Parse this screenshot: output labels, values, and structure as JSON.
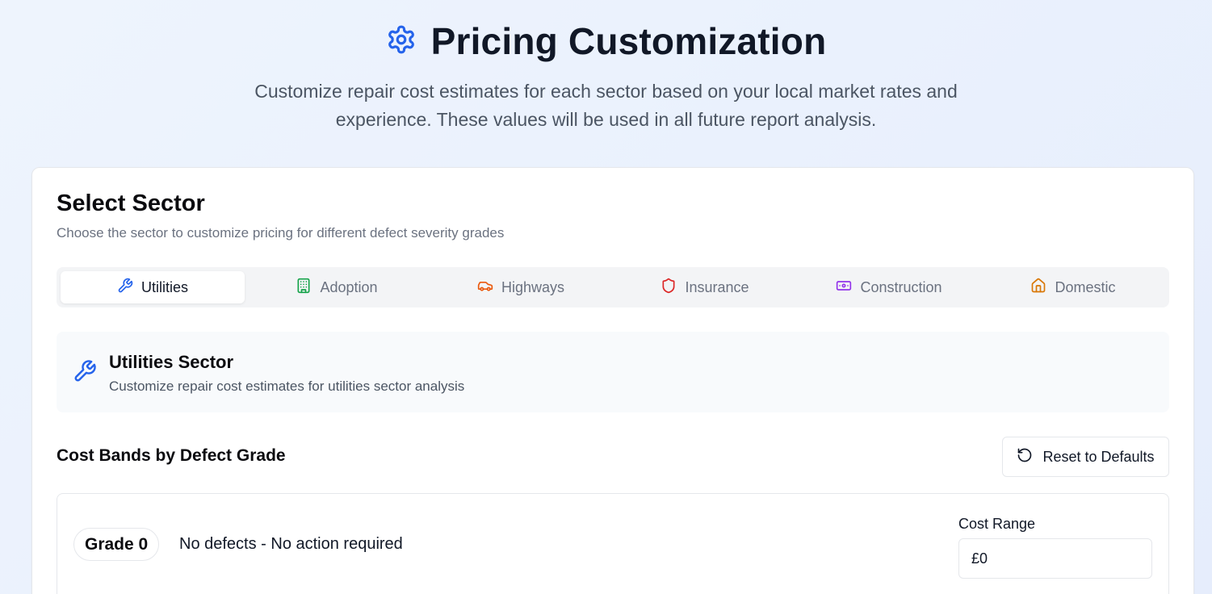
{
  "header": {
    "title": "Pricing Customization",
    "subtitle": "Customize repair cost estimates for each sector based on your local market rates and experience. These values will be used in all future report analysis.",
    "icon": "gear-icon"
  },
  "sector_select": {
    "title": "Select Sector",
    "description": "Choose the sector to customize pricing for different defect severity grades",
    "tabs": [
      {
        "label": "Utilities",
        "icon": "wrench-icon",
        "color": "#2563eb",
        "active": true
      },
      {
        "label": "Adoption",
        "icon": "building-icon",
        "color": "#16a34a",
        "active": false
      },
      {
        "label": "Highways",
        "icon": "car-icon",
        "color": "#ea580c",
        "active": false
      },
      {
        "label": "Insurance",
        "icon": "shield-icon",
        "color": "#dc2626",
        "active": false
      },
      {
        "label": "Construction",
        "icon": "banknote-icon",
        "color": "#9333ea",
        "active": false
      },
      {
        "label": "Domestic",
        "icon": "home-icon",
        "color": "#d97706",
        "active": false
      }
    ]
  },
  "sector_info": {
    "title": "Utilities Sector",
    "description": "Customize repair cost estimates for utilities sector analysis",
    "icon": "wrench-icon"
  },
  "cost_bands": {
    "title": "Cost Bands by Defect Grade",
    "reset_label": "Reset to Defaults",
    "grades": [
      {
        "badge": "Grade 0",
        "description": "No defects - No action required",
        "cost_label": "Cost Range",
        "cost_value": "£0"
      }
    ]
  },
  "colors": {
    "accent": "#2563eb"
  }
}
